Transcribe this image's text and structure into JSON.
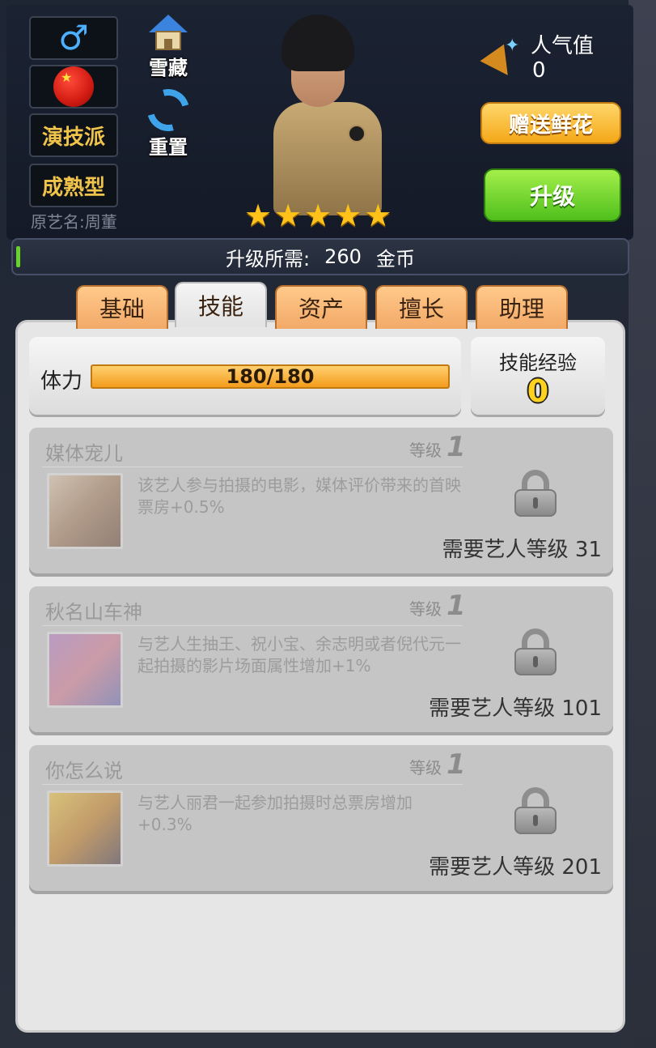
{
  "header": {
    "gender_symbol": "♂",
    "type_tag": "演技派",
    "age_tag": "成熟型",
    "original_name": "原艺名:周董",
    "collect_label": "雪藏",
    "reset_label": "重置",
    "star_count": 5,
    "stars": [
      "★",
      "★",
      "★",
      "★",
      "★"
    ],
    "popularity_label": "人气值",
    "popularity_value": "0",
    "gift_flower_label": "赠送鲜花",
    "upgrade_label": "升级",
    "upgrade_cost_prefix": "升级所需:",
    "upgrade_cost_value": "260",
    "upgrade_cost_unit": "金币"
  },
  "tabs": [
    {
      "label": "基础",
      "active": false
    },
    {
      "label": "技能",
      "active": true
    },
    {
      "label": "资产",
      "active": false
    },
    {
      "label": "擅长",
      "active": false
    },
    {
      "label": "助理",
      "active": false
    }
  ],
  "stamina": {
    "label": "体力",
    "value_text": "180/180",
    "current": 180,
    "max": 180
  },
  "skill_exp": {
    "label": "技能经验",
    "value": "0"
  },
  "skills": [
    {
      "name": "媒体宠儿",
      "level_label": "等级",
      "level": "1",
      "description": "该艺人参与拍摄的电影，媒体评价带来的首映票房+0.5%",
      "requirement": "需要艺人等级 31",
      "locked": true
    },
    {
      "name": "秋名山车神",
      "level_label": "等级",
      "level": "1",
      "description": "与艺人生抽王、祝小宝、余志明或者倪代元一起拍摄的影片场面属性增加+1%",
      "requirement": "需要艺人等级 101",
      "locked": true
    },
    {
      "name": "你怎么说",
      "level_label": "等级",
      "level": "1",
      "description": "与艺人丽君一起参加拍摄时总票房增加+0.3%",
      "requirement": "需要艺人等级 201",
      "locked": true
    }
  ],
  "colors": {
    "accent_gold": "#f0c34a",
    "button_orange": "#f4a818",
    "button_green": "#4fbf1c",
    "tab_orange": "#f2a968",
    "panel_bg": "#e6e6e6"
  }
}
